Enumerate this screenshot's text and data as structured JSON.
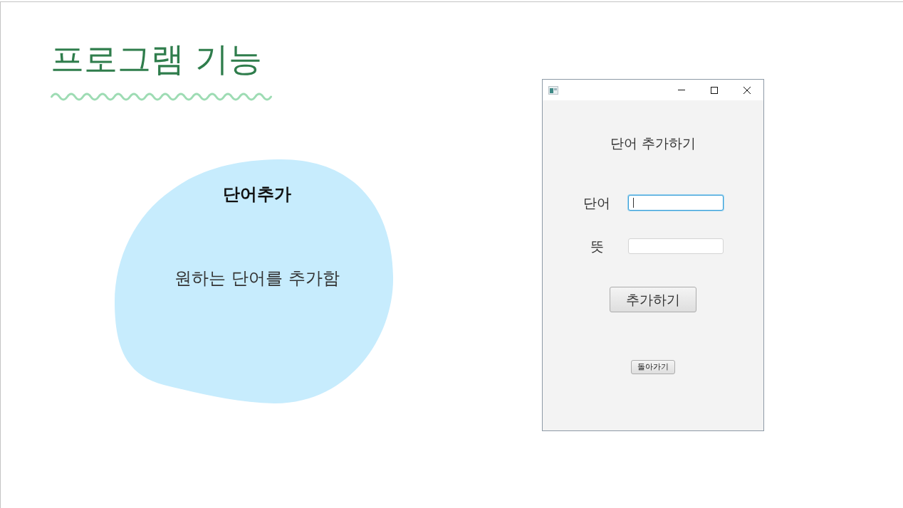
{
  "slide": {
    "title": "프로그램 기능"
  },
  "feature_card": {
    "heading": "단어추가",
    "description": "원하는 단어를 추가함"
  },
  "app_window": {
    "heading": "단어 추가하기",
    "fields": [
      {
        "label": "단어",
        "focused": true
      },
      {
        "label": "뜻",
        "focused": false
      }
    ],
    "add_button": "추가하기",
    "back_button": "돌아가기"
  }
}
